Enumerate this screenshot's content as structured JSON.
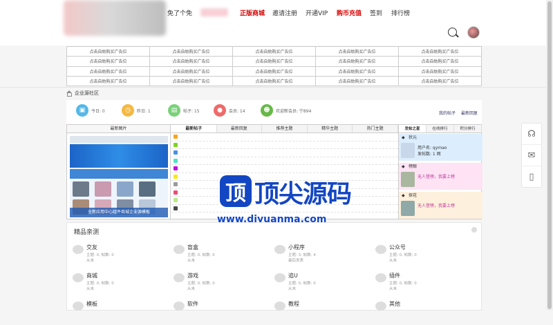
{
  "nav": {
    "items": [
      {
        "label": "免了个免",
        "style": "normal"
      },
      {
        "label": "正版商城",
        "style": "red"
      },
      {
        "label": "邀请注册",
        "style": "normal"
      },
      {
        "label": "开通VIP",
        "style": "normal"
      },
      {
        "label": "购币充值",
        "style": "red"
      },
      {
        "label": "签到",
        "style": "normal"
      },
      {
        "label": "排行榜",
        "style": "normal"
      }
    ]
  },
  "ads": {
    "cell_label": "点击自助购买广告位"
  },
  "breadcrumb": {
    "label": "企业源社区"
  },
  "stats": {
    "today": "今日: 0",
    "yesterday": "昨日: 1",
    "posts": "帖子: 15",
    "members": "会员: 14",
    "welcome": "欢迎新会员: 宁894",
    "my_posts": "我的帖子",
    "latest_reply": "最新回复"
  },
  "image_panel": {
    "header": "最新图片",
    "caption": "全新应用中心组件商城企业源模板"
  },
  "post_tabs": [
    "最新帖子",
    "最新回复",
    "推荐主题",
    "精华主题",
    "热门主题"
  ],
  "rank_tabs": [
    "发帖之星",
    "在线排行",
    "积分排行"
  ],
  "ranks": [
    {
      "title": "状元",
      "line1": "用户名: qymao",
      "line2": "发帖数: 1 网",
      "bg": "#dceefe",
      "icon": "#3a7cc6"
    },
    {
      "title": "榜眼",
      "line1": "无人登榜，我要上榜",
      "line2": "",
      "bg": "#fde3f4",
      "icon": "#c0399e"
    },
    {
      "title": "探花",
      "line1": "无人登榜，我要上榜",
      "line2": "",
      "bg": "#fdf0dc",
      "icon": "#d89a28"
    }
  ],
  "watermark": {
    "title": "顶尖源码",
    "logo": "顶",
    "url": "www.djyuanma.com"
  },
  "categories": {
    "title": "精品亲测",
    "items": [
      {
        "name": "交友",
        "line1": "主题: 0, 帖数: 0",
        "line2": "从未"
      },
      {
        "name": "盲盒",
        "line1": "主题: 0, 帖数: 0",
        "line2": "从未"
      },
      {
        "name": "小程序",
        "line1": "主题: 3, 帖数: 4",
        "line2": "最后发表"
      },
      {
        "name": "公众号",
        "line1": "主题: 0, 帖数: 0",
        "line2": "从未"
      },
      {
        "name": "商城",
        "line1": "主题: 0, 帖数: 0",
        "line2": "从未"
      },
      {
        "name": "游戏",
        "line1": "主题: 0, 帖数: 0",
        "line2": "从未"
      },
      {
        "name": "追U",
        "line1": "主题: 0, 帖数: 0",
        "line2": "从未"
      },
      {
        "name": "插件",
        "line1": "主题: 0, 帖数: 0",
        "line2": "从未"
      },
      {
        "name": "模板",
        "line1": "",
        "line2": ""
      },
      {
        "name": "软件",
        "line1": "",
        "line2": ""
      },
      {
        "name": "教程",
        "line1": "",
        "line2": ""
      },
      {
        "name": "其他",
        "line1": "",
        "line2": ""
      }
    ]
  },
  "colors": {
    "accent_red": "#d40000",
    "brand_blue": "#1346c2",
    "stat_today": "#54b8e8",
    "stat_yesterday": "#f5b942",
    "stat_posts": "#7bd17b",
    "stat_members": "#ef6a6a",
    "stat_welcome": "#67b948"
  },
  "float_icons": [
    "headset-icon",
    "wechat-icon",
    "mobile-icon"
  ]
}
